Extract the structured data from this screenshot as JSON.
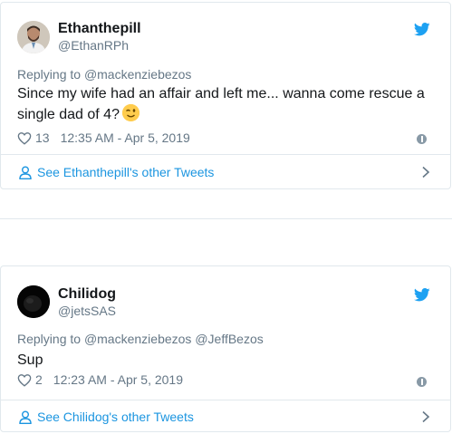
{
  "tweets": [
    {
      "name": "Ethanthepill",
      "handle": "@EthanRPh",
      "replying_prefix": "Replying to",
      "replying_to": "@mackenziebezos",
      "text": "Since my wife had an affair and left me... wanna come rescue a single dad of 4?",
      "emoji": "winking-face",
      "likes": "13",
      "timestamp": "12:35 AM - Apr 5, 2019",
      "see_more": "See Ethanthepill's other Tweets"
    },
    {
      "name": "Chilidog",
      "handle": "@jetsSAS",
      "replying_prefix": "Replying to",
      "replying_to": "@mackenziebezos @JeffBezos",
      "text": "Sup",
      "likes": "2",
      "timestamp": "12:23 AM - Apr 5, 2019",
      "see_more": "See Chilidog's other Tweets"
    }
  ],
  "colors": {
    "link": "#1b95e0",
    "muted": "#657786",
    "text": "#14171a",
    "border": "#e1e8ed",
    "twitter_blue": "#1da1f2"
  },
  "icons": [
    "twitter-bird-icon",
    "heart-icon",
    "info-icon",
    "person-icon",
    "chevron-right-icon",
    "winking-face-emoji"
  ]
}
